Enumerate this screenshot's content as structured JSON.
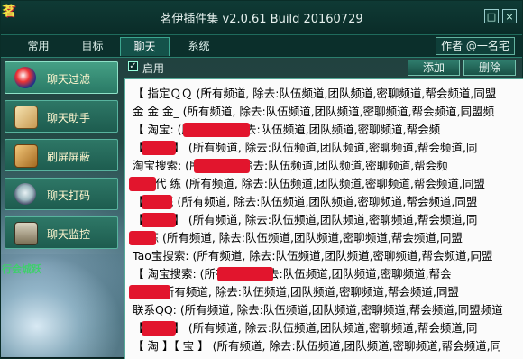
{
  "window": {
    "title": "茗伊插件集 v2.0.61 Build 20160729",
    "logo_text": "茗",
    "min_glyph": "□",
    "close_glyph": "×"
  },
  "tabs": [
    {
      "label": "常用"
    },
    {
      "label": "目标"
    },
    {
      "label": "聊天"
    },
    {
      "label": "系统"
    }
  ],
  "author_label": "作者 @一名宅",
  "sidebar": {
    "items": [
      {
        "label": "聊天过滤",
        "icon": "filter-icon"
      },
      {
        "label": "聊天助手",
        "icon": "assistant-icon"
      },
      {
        "label": "刷屏屏蔽",
        "icon": "block-icon"
      },
      {
        "label": "聊天打码",
        "icon": "mask-icon"
      },
      {
        "label": "聊天监控",
        "icon": "monitor-icon"
      }
    ]
  },
  "toolbar": {
    "enable_label": "启用",
    "enable_checked": "✓",
    "add_label": "添加",
    "delete_label": "删除"
  },
  "game_text": "行会城跃",
  "rules": [
    {
      "text": "【 指定ＱＱ (所有频道, 除去:队伍频道,团队频道,密聊频道,帮会频道,同盟"
    },
    {
      "text": "金 金 金_ (所有频道, 除去:队伍频道,团队频道,密聊频道,帮会频道,同盟频"
    },
    {
      "text": "【 淘宝:                 (所有频道, 除去:队伍频道,团队频道,密聊频道,帮会频"
    },
    {
      "text": "【         网游 】 (所有频道, 除去:队伍频道,团队频道,密聊频道,帮会频道,同"
    },
    {
      "text": "淘宝搜索:                (所有频道, 除去:队伍频道,团队频道,密聊频道,帮会频"
    },
    {
      "text": "        剑三代 练 (所有频道, 除去:队伍频道,团队频道,密聊频道,帮会频道,同盟"
    },
    {
      "text": "【         代 练 (所有频道, 除去:队伍频道,团队频道,密聊频道,帮会频道,同盟"
    },
    {
      "text": "【         剑三 】 (所有频道, 除去:队伍频道,团队频道,密聊频道,帮会频道,同"
    },
    {
      "text": "        代 练 (所有频道, 除去:队伍频道,团队频道,密聊频道,帮会频道,同盟"
    },
    {
      "text": "Tao宝搜索:     (所有频道, 除去:队伍频道,团队频道,密聊频道,帮会频道,同盟"
    },
    {
      "text": "【 淘宝搜索:                (所有频道, 除去:队伍频道,团队频道,密聊频道,帮会"
    },
    {
      "text": "         剑三 (所有频道, 除去:队伍频道,团队频道,密聊频道,帮会频道,同盟"
    },
    {
      "text": "联系QQ: (所有频道, 除去:队伍频道,团队频道,密聊频道,帮会频道,同盟频道"
    },
    {
      "text": "【         网游 】 (所有频道, 除去:队伍频道,团队频道,密聊频道,帮会频道,同"
    },
    {
      "text": "【 淘 】【 宝 】 (所有频道, 除去:队伍频道,团队频道,密聊频道,帮会频道,同"
    }
  ]
}
